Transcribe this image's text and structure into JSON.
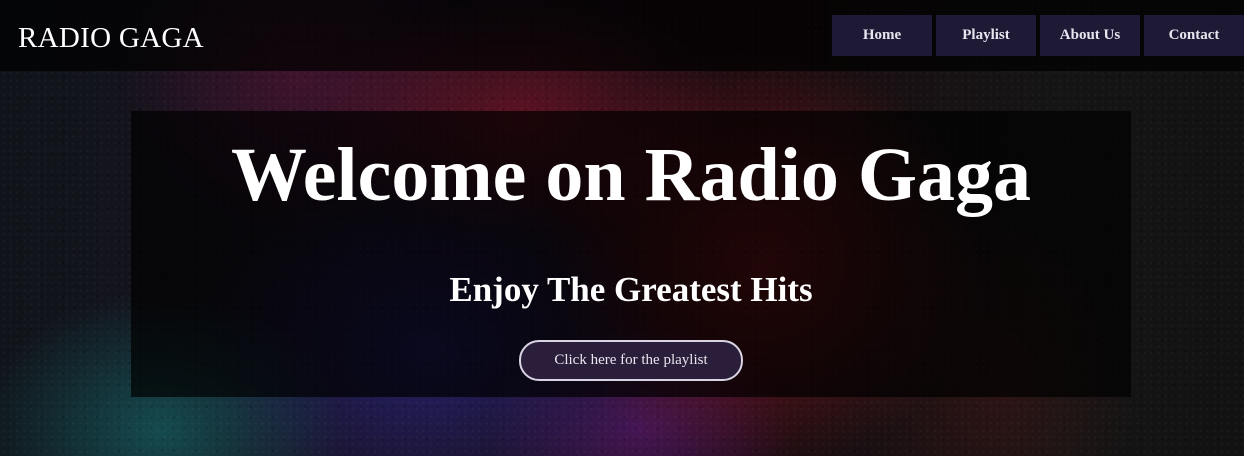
{
  "header": {
    "brand": "RADIO GAGA",
    "nav": [
      {
        "label": "Home"
      },
      {
        "label": "Playlist"
      },
      {
        "label": "About Us"
      },
      {
        "label": "Contact"
      }
    ]
  },
  "hero": {
    "title": "Welcome on Radio Gaga",
    "subtitle": "Enjoy The Greatest Hits",
    "cta_label": "Click here for the playlist"
  },
  "colors": {
    "nav_background": "#1e1a36",
    "cta_background": "#2a1e3a",
    "cta_border": "#d9d4e4",
    "text": "#ffffff"
  }
}
